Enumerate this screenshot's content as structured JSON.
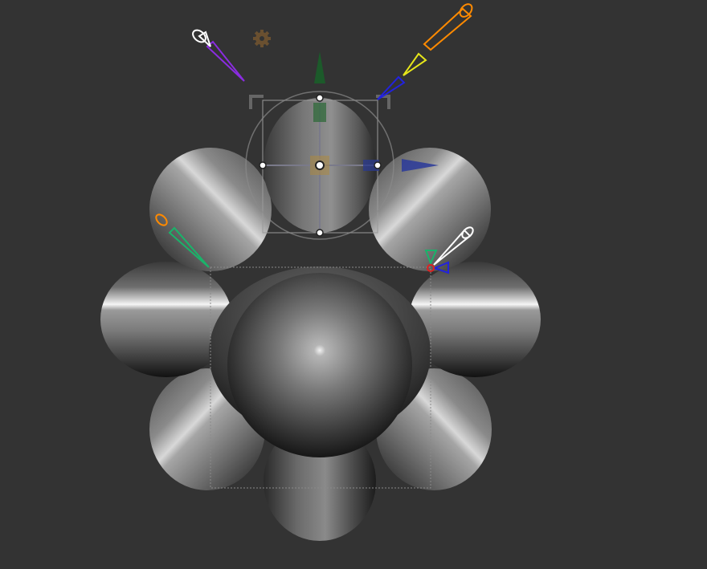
{
  "viewport": {
    "background": "#333333"
  },
  "scene": {
    "object": "sphere-cluster-mesh",
    "spheres": [
      "top",
      "upper-left",
      "upper-right",
      "left",
      "right",
      "lower-left",
      "lower-right",
      "bottom",
      "center"
    ]
  },
  "gizmo": {
    "axis_colors": {
      "x": "#1e2a8c",
      "y": "#1c5a2a",
      "z": "#c8a040"
    },
    "handles": [
      "move-y",
      "move-x",
      "center",
      "rotate-ring",
      "bounding-box"
    ]
  },
  "lights": [
    {
      "name": "white-light",
      "color": "#ffffff"
    },
    {
      "name": "purple-light",
      "color": "#8a2ce0"
    },
    {
      "name": "orange-light",
      "color": "#ff8a00"
    },
    {
      "name": "yellow-light",
      "color": "#e6e61a"
    },
    {
      "name": "blue-light",
      "color": "#2222dd"
    },
    {
      "name": "green-light",
      "color": "#1ab36a"
    },
    {
      "name": "red-light",
      "color": "#dd2222"
    }
  ],
  "icons": {
    "settings": "gear-icon"
  }
}
